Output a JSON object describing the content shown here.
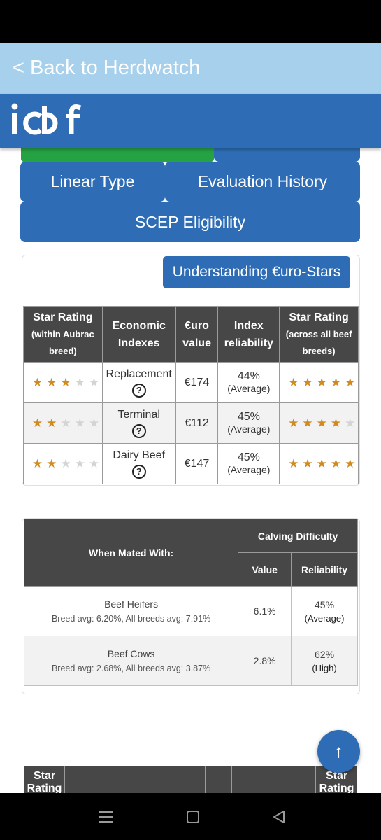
{
  "header": {
    "back_label": "< Back to Herdwatch",
    "logo_text": "icbf"
  },
  "tabs": {
    "linear_type": "Linear Type",
    "evaluation_history": "Evaluation History",
    "scep_eligibility": "SCEP Eligibility"
  },
  "understanding_button": "Understanding €uro-Stars",
  "euro_table": {
    "headers": {
      "star_rating_breed": "Star Rating",
      "star_rating_breed_sub": "(within Aubrac breed)",
      "economic_indexes": "Economic Indexes",
      "euro_value": "€uro value",
      "index_reliability": "Index reliability",
      "star_rating_all": "Star Rating",
      "star_rating_all_sub": "(across all beef breeds)"
    },
    "rows": [
      {
        "breed_stars": 3,
        "index": "Replacement",
        "value": "€174",
        "reliability": "44%",
        "reliability_label": "(Average)",
        "all_stars": 5
      },
      {
        "breed_stars": 2,
        "index": "Terminal",
        "value": "€112",
        "reliability": "45%",
        "reliability_label": "(Average)",
        "all_stars": 4
      },
      {
        "breed_stars": 2,
        "index": "Dairy Beef",
        "value": "€147",
        "reliability": "45%",
        "reliability_label": "(Average)",
        "all_stars": 5
      }
    ],
    "star_max": 5,
    "help_icon": "question-circle-icon"
  },
  "calving_table": {
    "headers": {
      "when_mated_with": "When Mated With:",
      "calving_difficulty": "Calving Difficulty",
      "value": "Value",
      "reliability": "Reliability"
    },
    "rows": [
      {
        "label": "Beef Heifers",
        "sub": "Breed avg: 6.20%, All breeds avg: 7.91%",
        "value": "6.1%",
        "reliability": "45%",
        "reliability_label": "(Average)"
      },
      {
        "label": "Beef Cows",
        "sub": "Breed avg: 2.68%, All breeds avg: 3.87%",
        "value": "2.8%",
        "reliability": "62%",
        "reliability_label": "(High)"
      }
    ]
  },
  "next_table": {
    "col_first": "Star Rating",
    "col_last": "Star Rating"
  },
  "fab": {
    "icon": "arrow-up-icon",
    "glyph": "↑"
  },
  "nav": {
    "recents_icon": "menu-lines-icon",
    "home_icon": "square-icon",
    "back_icon": "triangle-back-icon"
  },
  "colors": {
    "primary_blue": "#2e6db5",
    "light_blue": "#a6d0ec",
    "green_tab": "#25a244",
    "table_header": "#474747",
    "star_gold": "#d18a1e"
  }
}
